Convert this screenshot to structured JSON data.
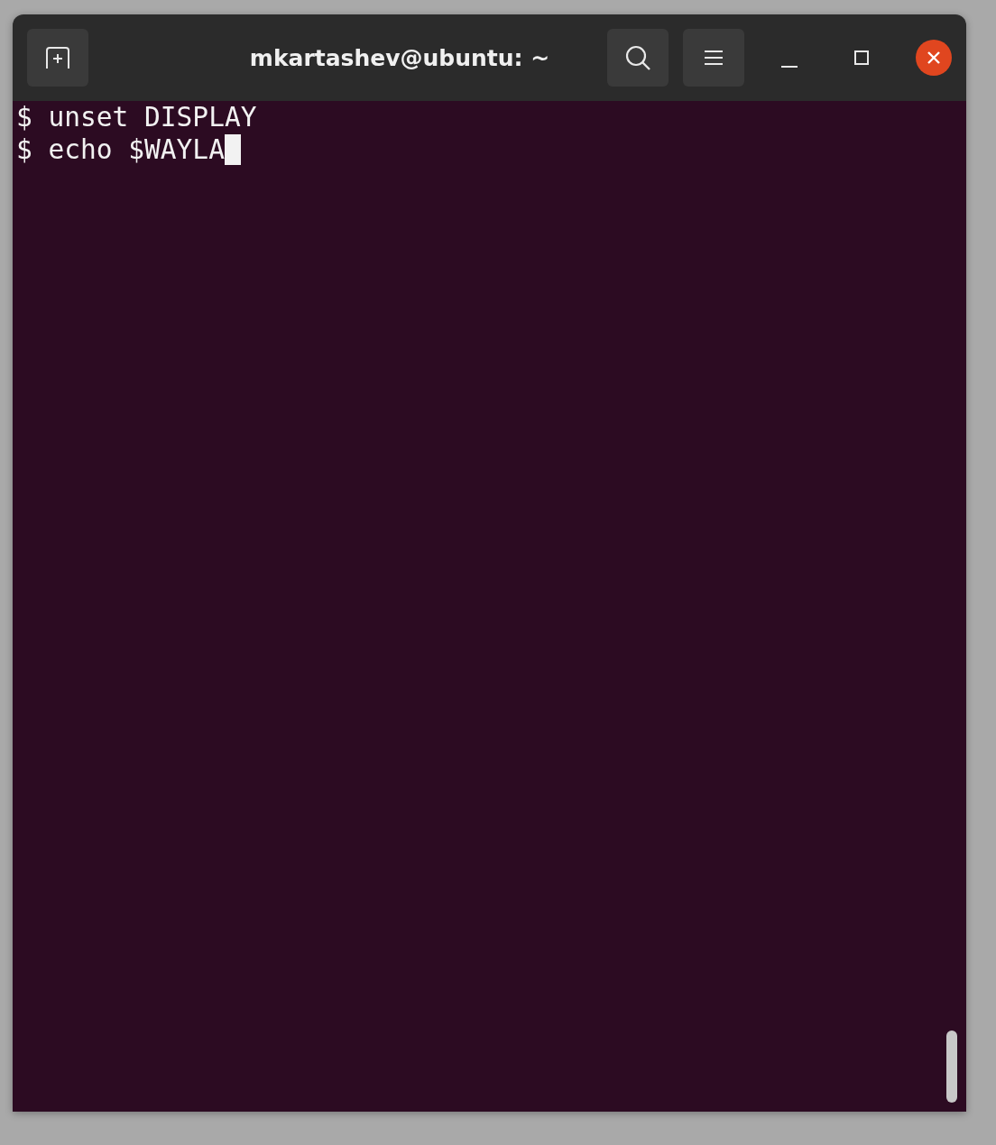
{
  "window": {
    "title": "mkartashev@ubuntu: ~"
  },
  "terminal": {
    "lines": [
      "$ unset DISPLAY",
      "$ echo $WAYLA"
    ]
  }
}
